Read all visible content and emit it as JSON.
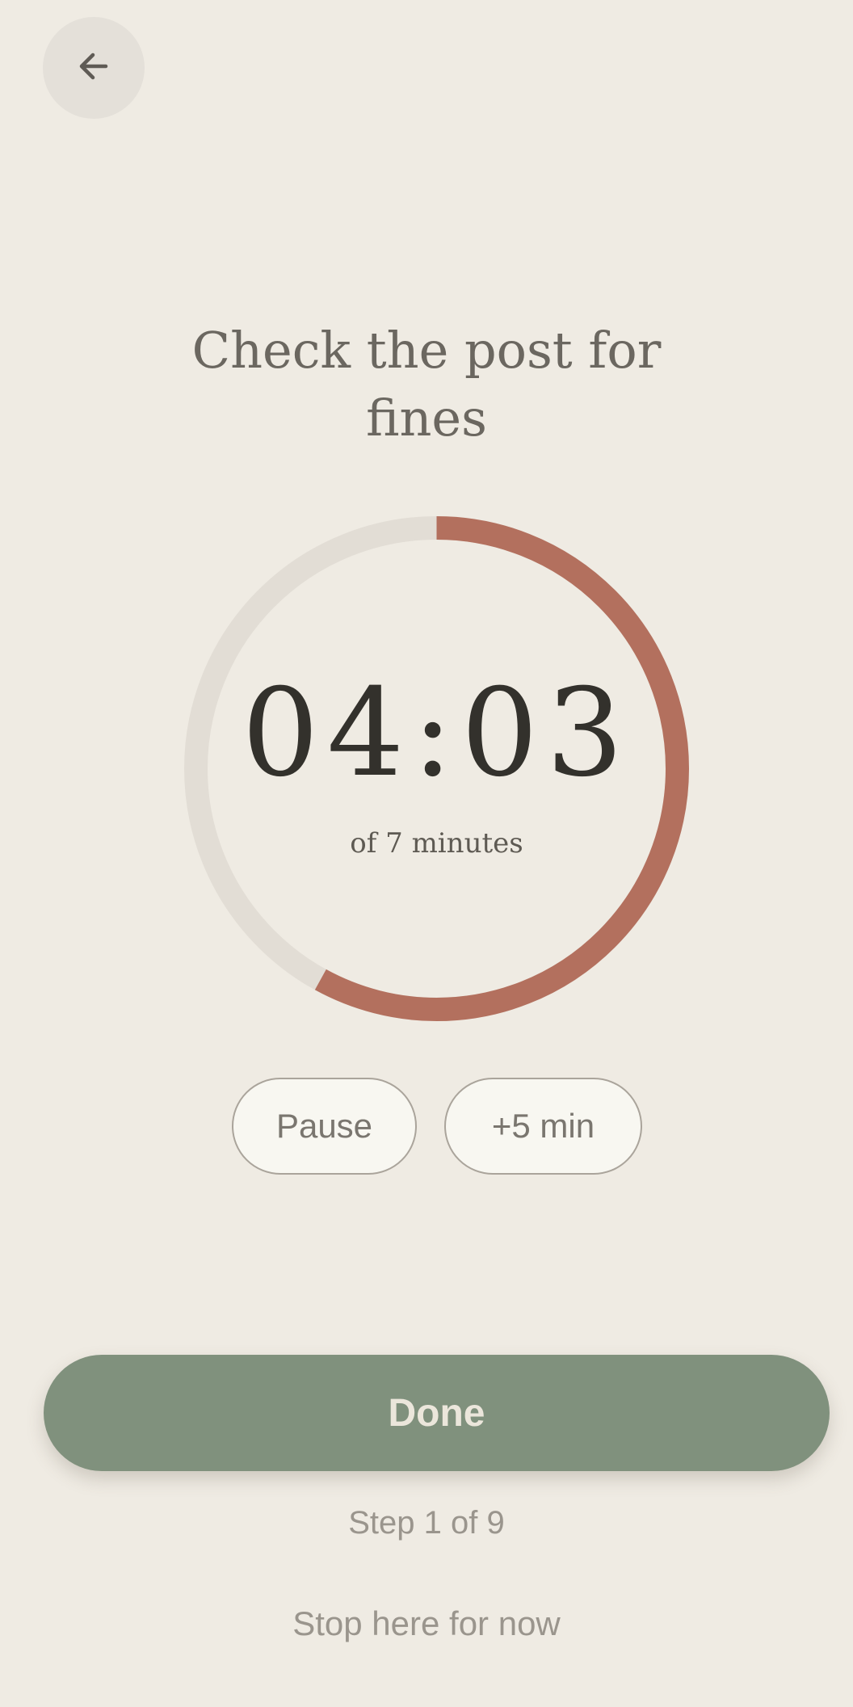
{
  "header": {
    "back_icon": "arrow-left-icon"
  },
  "task": {
    "title": "Check the post for fines"
  },
  "timer": {
    "time_display": "04:03",
    "subtitle": "of 7 minutes",
    "progress_fraction": 0.58,
    "track_color": "#e2ddd5",
    "progress_color": "#b3705e"
  },
  "controls": {
    "pause_label": "Pause",
    "add_time_label": "+5 min"
  },
  "footer": {
    "done_label": "Done",
    "step_text": "Step 1 of 9",
    "stop_label": "Stop here for now"
  },
  "colors": {
    "background": "#efebe3",
    "done_button": "#80917d"
  }
}
